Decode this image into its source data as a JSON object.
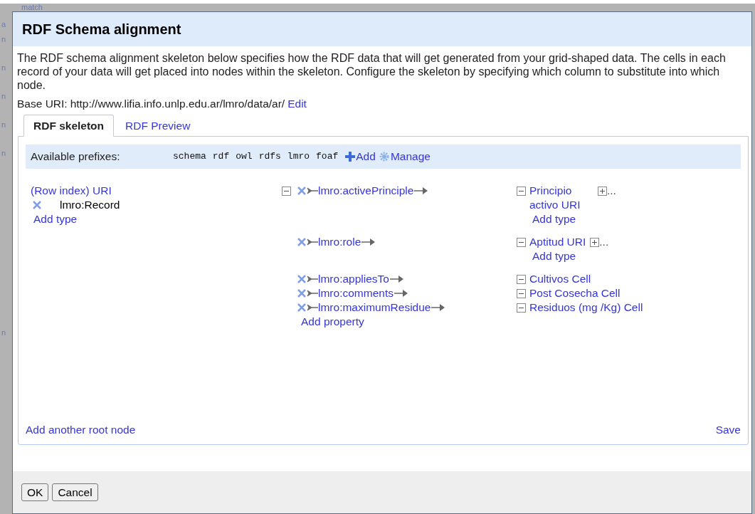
{
  "background": {
    "header": "match",
    "letters": [
      "a",
      "n",
      "n",
      "n",
      "n",
      "n",
      "n"
    ]
  },
  "dialog": {
    "title": "RDF Schema alignment",
    "description": "The RDF schema alignment skeleton below specifies how the RDF data that will get generated from your grid-shaped data. The cells in each record of your data will get placed into nodes within the skeleton. Configure the skeleton by specifying which column to substitute into which node.",
    "base_uri_label": "Base URI:",
    "base_uri": "http://www.lifia.info.unlp.edu.ar/lmro/data/ar/",
    "edit_link": "Edit"
  },
  "tabs": [
    {
      "label": "RDF skeleton",
      "selected": true
    },
    {
      "label": "RDF Preview",
      "selected": false
    }
  ],
  "prefixes": {
    "label": "Available prefixes:",
    "items": [
      "schema",
      "rdf",
      "owl",
      "rdfs",
      "lmro",
      "foaf"
    ],
    "add": "Add",
    "manage": "Manage"
  },
  "root_node": {
    "label": "(Row index) URI",
    "type": "lmro:Record",
    "add_type": "Add type",
    "expanded": true
  },
  "properties": [
    {
      "name": "lmro:activePrinciple",
      "target": {
        "label": "Principio activo URI",
        "expanded": true,
        "more": "...",
        "add_type": "Add type"
      }
    },
    {
      "name": "lmro:role",
      "target": {
        "label": "Aptitud URI",
        "expanded": true,
        "more": "...",
        "add_type": "Add type"
      }
    },
    {
      "name": "lmro:appliesTo",
      "target": {
        "label": "Cultivos Cell",
        "expanded": true
      }
    },
    {
      "name": "lmro:comments",
      "target": {
        "label": "Post Cosecha Cell",
        "expanded": true
      }
    },
    {
      "name": "lmro:maximumResidue",
      "target": {
        "label": "Residuos (mg /Kg) Cell",
        "expanded": true
      }
    }
  ],
  "add_property": "Add property",
  "add_root": "Add another root node",
  "save": "Save",
  "buttons": [
    "OK",
    "Cancel"
  ]
}
